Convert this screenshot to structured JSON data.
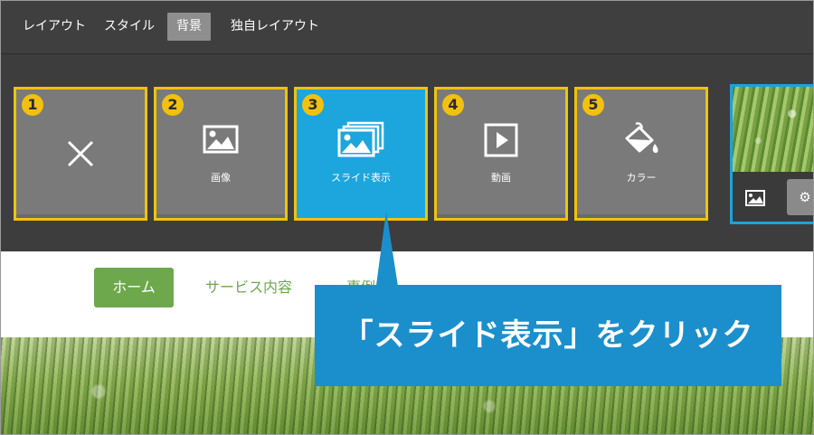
{
  "tabs": [
    {
      "label": "レイアウト",
      "active": false
    },
    {
      "label": "スタイル",
      "active": false
    },
    {
      "label": "背景",
      "active": true
    },
    {
      "label": "独自レイアウト",
      "active": false
    }
  ],
  "tiles": [
    {
      "number": "1",
      "icon": "close-icon",
      "label": ""
    },
    {
      "number": "2",
      "icon": "image-icon",
      "label": "画像"
    },
    {
      "number": "3",
      "icon": "slideshow-icon",
      "label": "スライド表示",
      "selected": true
    },
    {
      "number": "4",
      "icon": "play-icon",
      "label": "動画"
    },
    {
      "number": "5",
      "icon": "paint-bucket-icon",
      "label": "カラー"
    }
  ],
  "preview": {
    "buttons": [
      "image-icon",
      "gear-icon"
    ]
  },
  "site_nav": [
    {
      "label": "ホーム",
      "active": true
    },
    {
      "label": "サービス内容",
      "active": false
    },
    {
      "label": "事例",
      "active": false
    }
  ],
  "callout": {
    "text": "「スライド表示」をクリック"
  },
  "colors": {
    "accent_yellow": "#f1c20d",
    "selected_blue": "#1ca6dd",
    "callout_blue": "#1b8fcc",
    "nav_green": "#6da84c"
  }
}
